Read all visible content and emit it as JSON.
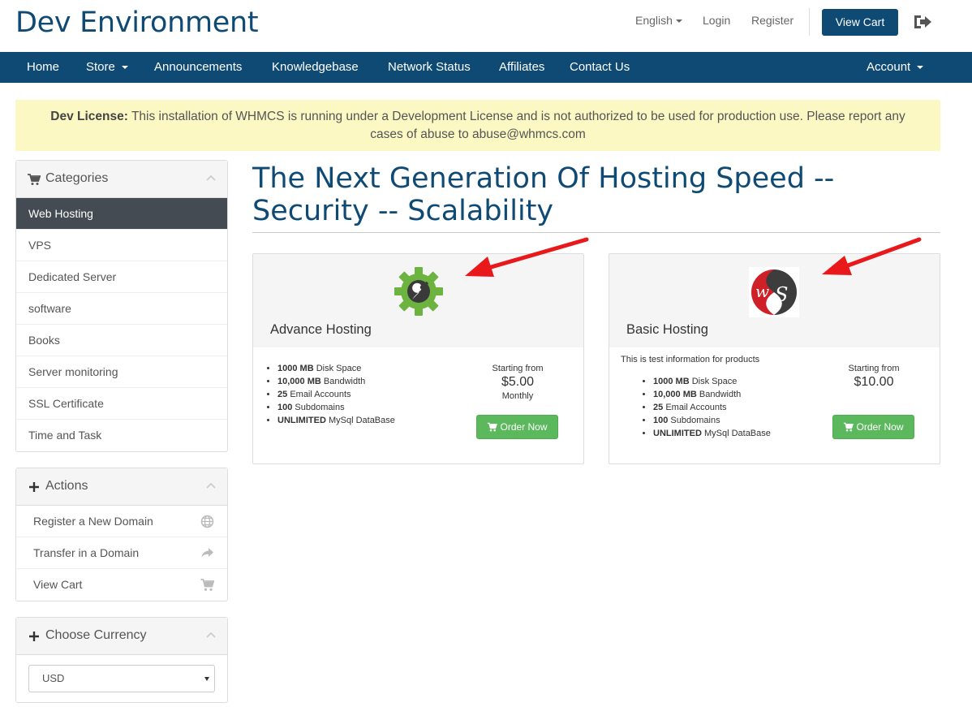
{
  "header": {
    "brand": "Dev Environment",
    "language": "English",
    "login": "Login",
    "register": "Register",
    "view_cart": "View Cart"
  },
  "nav": {
    "items": [
      "Home",
      "Store",
      "Announcements",
      "Knowledgebase",
      "Network Status",
      "Affiliates",
      "Contact Us"
    ],
    "account": "Account"
  },
  "alert": {
    "label": "Dev License:",
    "message": "This installation of WHMCS is running under a Development License and is not authorized to be used for production use. Please report any cases of abuse to abuse@whmcs.com"
  },
  "sidebar": {
    "categories": {
      "title": "Categories",
      "items": [
        "Web Hosting",
        "VPS",
        "Dedicated Server",
        "software",
        "Books",
        "Server monitoring",
        "SSL Certificate",
        "Time and Task"
      ],
      "active": "Web Hosting"
    },
    "actions": {
      "title": "Actions",
      "items": [
        "Register a New Domain",
        "Transfer in a Domain",
        "View Cart"
      ]
    },
    "currency": {
      "title": "Choose Currency",
      "selected": "USD"
    }
  },
  "main": {
    "title": "The Next Generation Of Hosting Speed -- Security -- Scalability",
    "products": [
      {
        "name": "Advance Hosting",
        "description": "",
        "features": [
          {
            "value": "1000 MB",
            "label": "Disk Space"
          },
          {
            "value": "10,000 MB",
            "label": "Bandwidth"
          },
          {
            "value": "25",
            "label": "Email Accounts"
          },
          {
            "value": "100",
            "label": "Subdomains"
          },
          {
            "value": "UNLIMITED",
            "label": "MySql DataBase"
          }
        ],
        "starting_from": "Starting from",
        "price": "$5.00",
        "cycle": "Monthly",
        "order_label": "Order Now"
      },
      {
        "name": "Basic Hosting",
        "description": "This is test information for products",
        "features": [
          {
            "value": "1000 MB",
            "label": "Disk Space"
          },
          {
            "value": "10,000 MB",
            "label": "Bandwidth"
          },
          {
            "value": "25",
            "label": "Email Accounts"
          },
          {
            "value": "100",
            "label": "Subdomains"
          },
          {
            "value": "UNLIMITED",
            "label": "MySql DataBase"
          }
        ],
        "starting_from": "Starting from",
        "price": "$10.00",
        "cycle": "",
        "order_label": "Order Now"
      }
    ]
  },
  "colors": {
    "brand": "#0e4a74",
    "alert_bg": "#fcf8c3",
    "active_item": "#444b52",
    "order_button": "#5cb85c",
    "gear": "#6cb33f",
    "annotation_arrow": "#e8181b"
  }
}
